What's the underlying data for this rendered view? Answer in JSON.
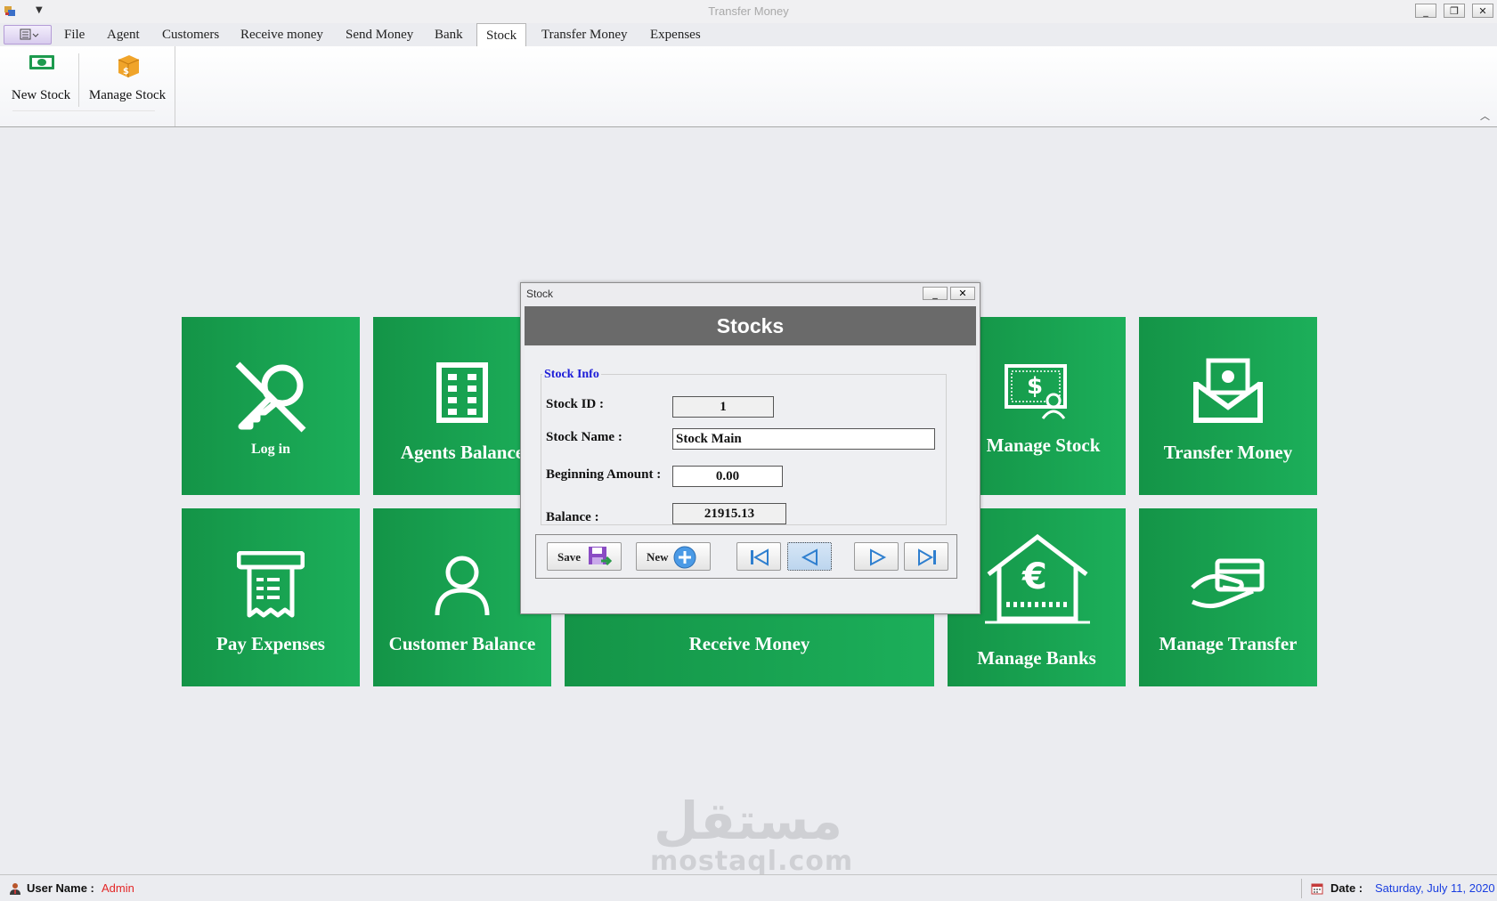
{
  "window": {
    "title": "Transfer Money"
  },
  "tabs": [
    {
      "label": "File"
    },
    {
      "label": "Agent"
    },
    {
      "label": "Customers"
    },
    {
      "label": "Receive money"
    },
    {
      "label": "Send Money"
    },
    {
      "label": "Bank"
    },
    {
      "label": "Stock",
      "active": true
    },
    {
      "label": "Transfer Money"
    },
    {
      "label": "Expenses"
    }
  ],
  "ribbon": {
    "new_stock": "New Stock",
    "manage_stock": "Manage Stock"
  },
  "tiles": {
    "log_in": "Log in",
    "agents_balance": "Agents Balance",
    "manage_stock": "Manage Stock",
    "transfer_money": "Transfer Money",
    "pay_expenses": "Pay Expenses",
    "customer_balance": "Customer Balance",
    "receive_money": "Receive Money",
    "manage_banks": "Manage Banks",
    "manage_transfer": "Manage Transfer"
  },
  "dialog": {
    "window_title": "Stock",
    "header": "Stocks",
    "group_title": "Stock Info",
    "stock_id_label": "Stock ID :",
    "stock_id_value": "1",
    "stock_name_label": "Stock Name :",
    "stock_name_value": "Stock Main",
    "beginning_amount_label": "Beginning Amount :",
    "beginning_amount_value": "0.00",
    "balance_label": "Balance :",
    "balance_value": "21915.13",
    "save_label": "Save",
    "new_label": "New"
  },
  "status": {
    "user_label": "User Name :",
    "user_value": "Admin",
    "date_label": "Date :",
    "date_value": "Saturday, July 11, 2020"
  },
  "watermark": {
    "arabic": "مستقل",
    "latin": "mostaql.com"
  },
  "colors": {
    "tile_green": "#1aa553",
    "dialog_header": "#6a6a6a",
    "group_title": "#1d1dd8",
    "user_value": "#e32626",
    "date_value": "#1a3ee0"
  }
}
